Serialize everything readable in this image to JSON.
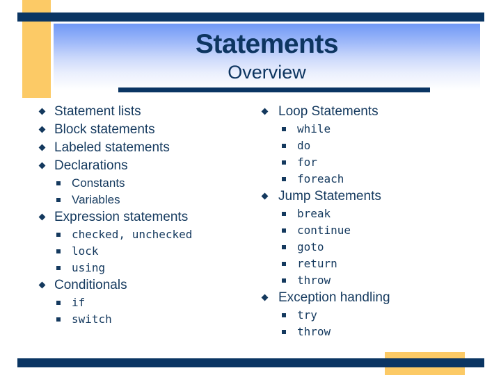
{
  "slide": {
    "title": "Statements",
    "subtitle": "Overview",
    "colors": {
      "dark_blue": "#0a3563",
      "accent_yellow": "#fcca66",
      "gradient_top": "#6f98f6",
      "text_blue": "#14395e"
    }
  },
  "left_column": [
    {
      "level": 1,
      "text": "Statement lists",
      "mono": false
    },
    {
      "level": 1,
      "text": "Block statements",
      "mono": false
    },
    {
      "level": 1,
      "text": "Labeled statements",
      "mono": false
    },
    {
      "level": 1,
      "text": "Declarations",
      "mono": false
    },
    {
      "level": 2,
      "text": "Constants",
      "mono": false
    },
    {
      "level": 2,
      "text": "Variables",
      "mono": false
    },
    {
      "level": 1,
      "text": "Expression statements",
      "mono": false
    },
    {
      "level": 2,
      "text": "checked, unchecked",
      "mono": true
    },
    {
      "level": 2,
      "text": "lock",
      "mono": true
    },
    {
      "level": 2,
      "text": "using",
      "mono": true
    },
    {
      "level": 1,
      "text": "Conditionals",
      "mono": false
    },
    {
      "level": 2,
      "text": "if",
      "mono": true
    },
    {
      "level": 2,
      "text": "switch",
      "mono": true
    }
  ],
  "right_column": [
    {
      "level": 1,
      "text": "Loop Statements",
      "mono": false
    },
    {
      "level": 2,
      "text": "while",
      "mono": true
    },
    {
      "level": 2,
      "text": "do",
      "mono": true
    },
    {
      "level": 2,
      "text": "for",
      "mono": true
    },
    {
      "level": 2,
      "text": "foreach",
      "mono": true
    },
    {
      "level": 1,
      "text": "Jump Statements",
      "mono": false
    },
    {
      "level": 2,
      "text": "break",
      "mono": true
    },
    {
      "level": 2,
      "text": "continue",
      "mono": true
    },
    {
      "level": 2,
      "text": "goto",
      "mono": true
    },
    {
      "level": 2,
      "text": "return",
      "mono": true
    },
    {
      "level": 2,
      "text": "throw",
      "mono": true
    },
    {
      "level": 1,
      "text": "Exception handling",
      "mono": false
    },
    {
      "level": 2,
      "text": "try",
      "mono": true
    },
    {
      "level": 2,
      "text": "throw",
      "mono": true
    }
  ]
}
